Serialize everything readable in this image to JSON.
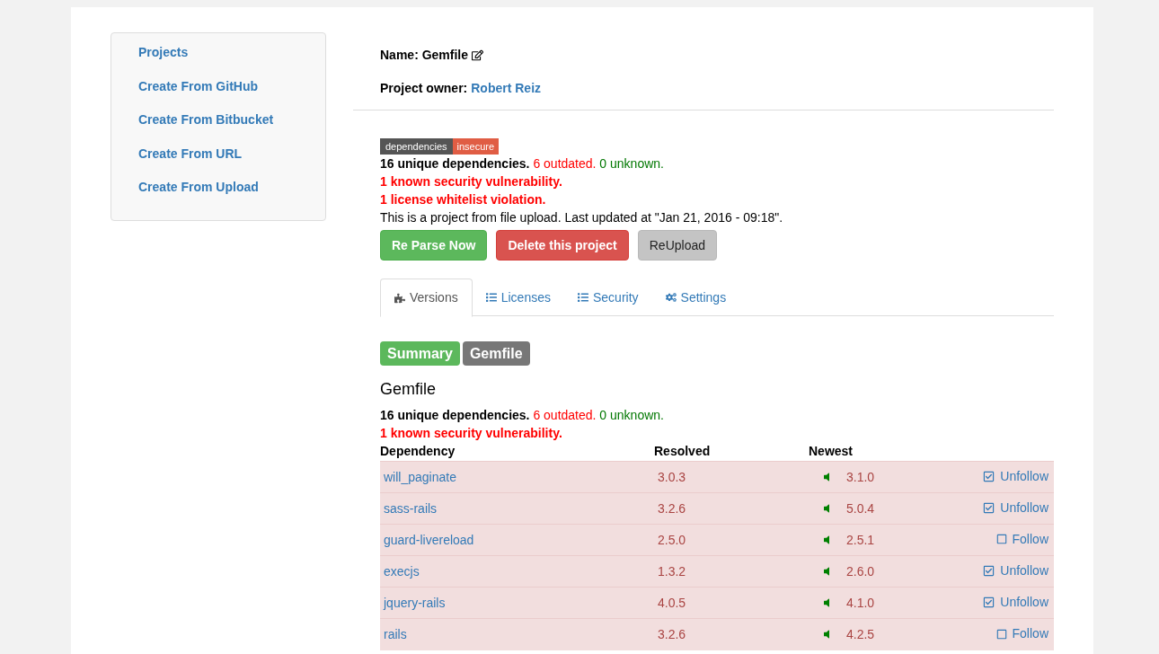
{
  "sidebar": {
    "items": [
      {
        "label": "Projects"
      },
      {
        "label": "Create From GitHub"
      },
      {
        "label": "Create From Bitbucket"
      },
      {
        "label": "Create From URL"
      },
      {
        "label": "Create From Upload"
      }
    ]
  },
  "project": {
    "name_label": "Name:",
    "name": "Gemfile",
    "owner_label": "Project owner:",
    "owner": "Robert Reiz"
  },
  "badge": {
    "left": "dependencies",
    "right": "insecure"
  },
  "summary": {
    "unique": "16 unique dependencies.",
    "outdated": "6 outdated.",
    "unknown": "0 unknown.",
    "security": "1 known security vulnerability.",
    "license": "1 license whitelist violation.",
    "info": "This is a project from file upload. Last updated at \"Jan 21, 2016 - 09:18\"."
  },
  "buttons": [
    {
      "label": "Re Parse Now",
      "kind": "success"
    },
    {
      "label": "Delete this project",
      "kind": "danger"
    },
    {
      "label": "ReUpload",
      "kind": "default"
    }
  ],
  "tabs": [
    {
      "label": "Versions",
      "selected": true
    },
    {
      "label": "Licenses",
      "selected": false
    },
    {
      "label": "Security",
      "selected": false
    },
    {
      "label": "Settings",
      "selected": false
    }
  ],
  "subtabs": [
    {
      "label": "Summary",
      "selected": true
    },
    {
      "label": "Gemfile",
      "selected": false
    }
  ],
  "file": {
    "title": "Gemfile",
    "unique": "16 unique dependencies.",
    "outdated": "6 outdated.",
    "unknown": "0 unknown.",
    "security": "1 known security vulnerability."
  },
  "table": {
    "columns": [
      "Dependency",
      "Resolved",
      "Newest"
    ],
    "rows": [
      {
        "name": "will_paginate",
        "resolved": "3.0.3",
        "newest": "3.1.0",
        "following": true,
        "action": "Unfollow"
      },
      {
        "name": "sass-rails",
        "resolved": "3.2.6",
        "newest": "5.0.4",
        "following": true,
        "action": "Unfollow"
      },
      {
        "name": "guard-livereload",
        "resolved": "2.5.0",
        "newest": "2.5.1",
        "following": false,
        "action": "Follow"
      },
      {
        "name": "execjs",
        "resolved": "1.3.2",
        "newest": "2.6.0",
        "following": true,
        "action": "Unfollow"
      },
      {
        "name": "jquery-rails",
        "resolved": "4.0.5",
        "newest": "4.1.0",
        "following": true,
        "action": "Unfollow"
      },
      {
        "name": "rails",
        "resolved": "3.2.6",
        "newest": "4.2.5",
        "following": false,
        "action": "Follow"
      }
    ]
  }
}
